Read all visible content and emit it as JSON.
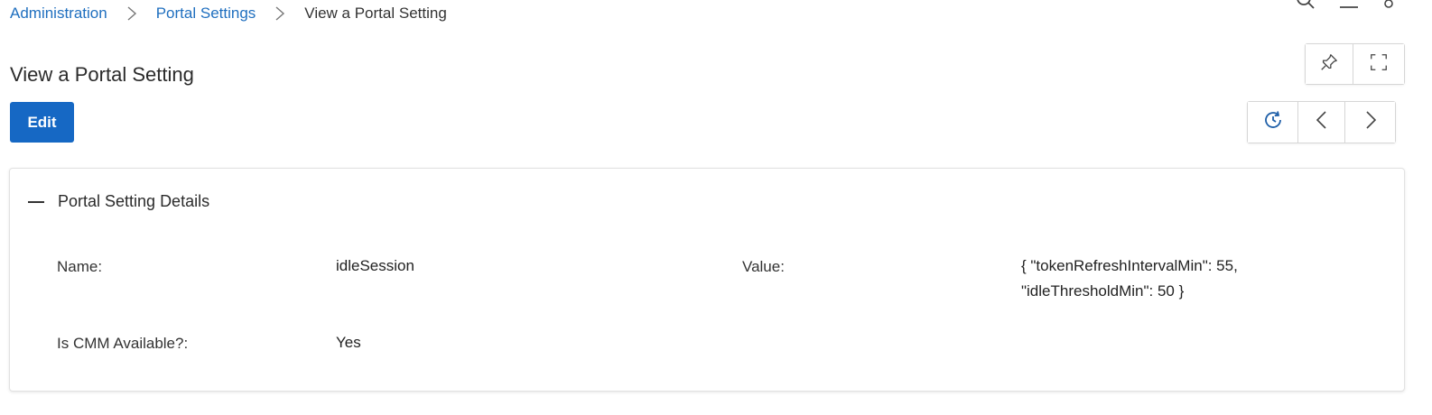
{
  "breadcrumb": {
    "items": [
      {
        "label": "Administration"
      },
      {
        "label": "Portal Settings"
      },
      {
        "label": "View a Portal Setting"
      }
    ]
  },
  "page": {
    "title": "View a Portal Setting"
  },
  "header_actions": {
    "icons": [
      "pin-icon",
      "fullscreen-icon"
    ]
  },
  "toolbar": {
    "edit_label": "Edit",
    "icons": [
      "history-icon",
      "chevron-left-icon",
      "chevron-right-icon"
    ]
  },
  "panel": {
    "title": "Portal Setting Details",
    "fields": {
      "name_label": "Name:",
      "name_value": "idleSession",
      "value_label": "Value:",
      "value_line1": "{ \"tokenRefreshIntervalMin\": 55,",
      "value_line2": "\"idleThresholdMin\": 50 }",
      "cmm_label": "Is CMM Available?:",
      "cmm_value": "Yes"
    }
  },
  "colors": {
    "accent": "#1668c4",
    "link": "#1f6fbf",
    "border": "#d6d6d6"
  }
}
